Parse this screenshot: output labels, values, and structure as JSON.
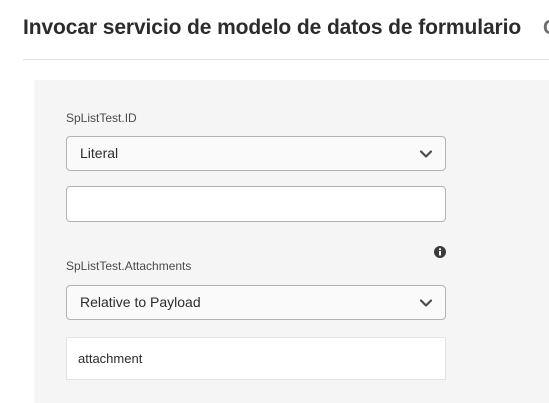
{
  "header": {
    "title": "Invocar servicio de modelo de datos de formulario",
    "extra": "C"
  },
  "fields": [
    {
      "label": "SpListTest.ID",
      "select_value": "Literal",
      "input_value": ""
    },
    {
      "label": "SpListTest.Attachments",
      "select_value": "Relative to Payload",
      "input_value": "attachment"
    }
  ],
  "icons": {
    "dropdown": "chevron-down-icon",
    "info": "info-icon"
  },
  "colors": {
    "text": "#2c2c2c",
    "panel": "#f5f5f5",
    "border": "#b3b3b3"
  }
}
